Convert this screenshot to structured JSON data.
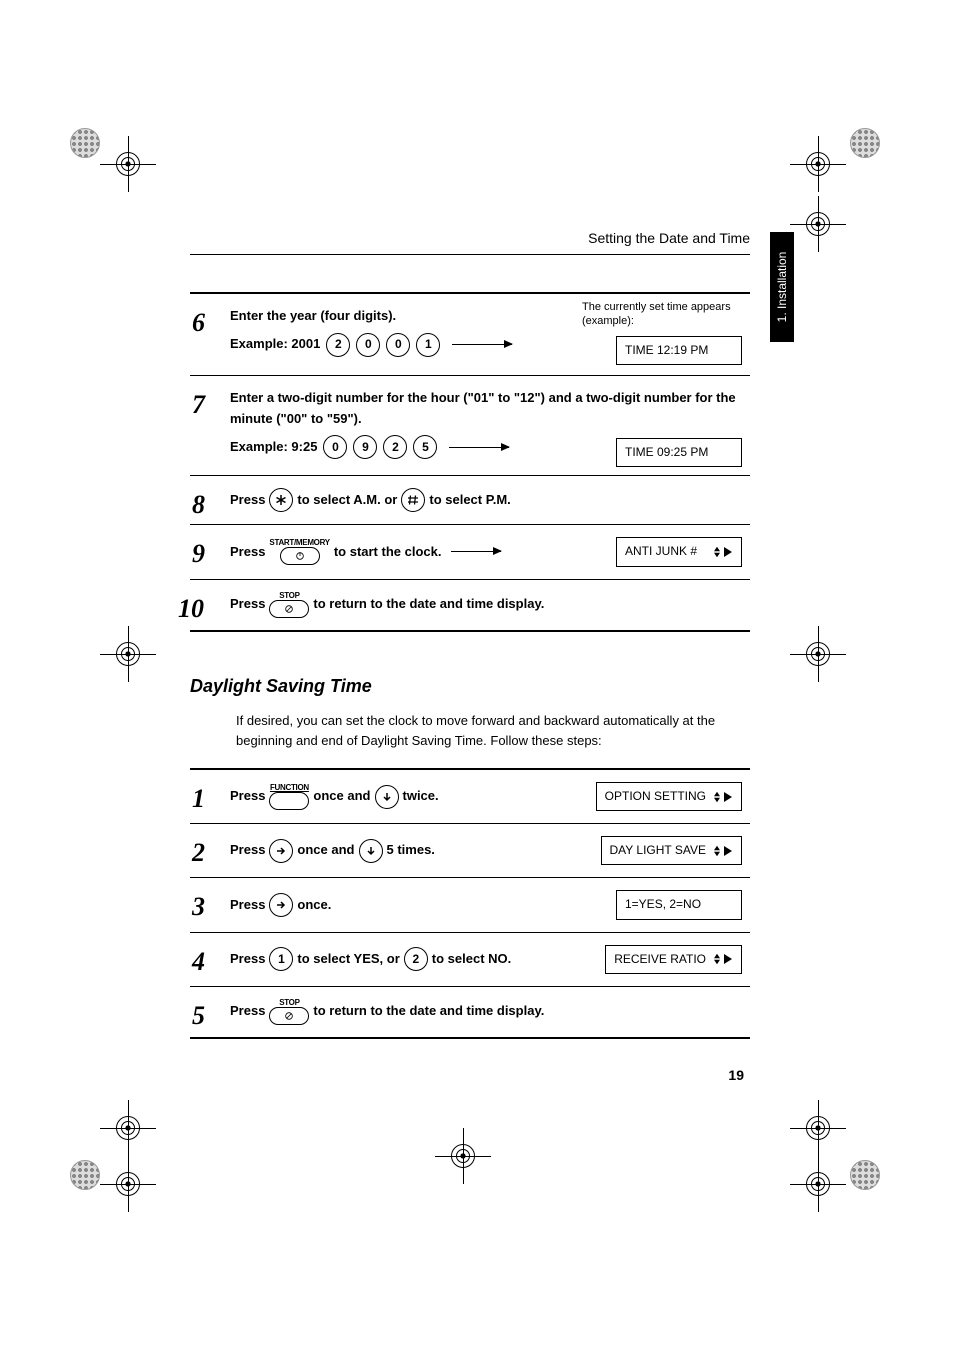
{
  "header": {
    "running_title": "Setting the Date and Time",
    "tab_label": "1. Installation",
    "page_number": "19"
  },
  "top_steps": {
    "s6": {
      "num": "6",
      "line1": "Enter the year (four digits).",
      "example_label": "Example: 2001",
      "keys": [
        "2",
        "0",
        "0",
        "1"
      ],
      "note": "The currently set time appears (example):",
      "display": "TIME 12:19 PM"
    },
    "s7": {
      "num": "7",
      "line1": "Enter a two-digit number for the hour (\"01\" to \"12\") and a two-digit number for the minute (\"00\" to \"59\").",
      "example_label": "Example: 9:25",
      "keys": [
        "0",
        "9",
        "2",
        "5"
      ],
      "display": "TIME 09:25 PM"
    },
    "s8": {
      "num": "8",
      "pre": "Press",
      "mid1": "to select A.M. or",
      "mid2": "to select P.M."
    },
    "s9": {
      "num": "9",
      "pre": "Press",
      "label": "START/MEMORY",
      "post": "to start the clock.",
      "display": "ANTI JUNK #"
    },
    "s10": {
      "num": "10",
      "pre": "Press",
      "label": "STOP",
      "post": "to return to the date and time display."
    }
  },
  "section2": {
    "heading": "Daylight Saving Time",
    "intro": "If desired, you can set the clock to move forward and backward automatically at the beginning and end of Daylight Saving Time. Follow these steps:",
    "s1": {
      "num": "1",
      "pre": "Press",
      "func_label": "FUNCTION",
      "mid": "once and",
      "post": "twice.",
      "display": "OPTION SETTING"
    },
    "s2": {
      "num": "2",
      "pre": "Press",
      "mid": "once and",
      "post": "5 times.",
      "display": "DAY LIGHT SAVE"
    },
    "s3": {
      "num": "3",
      "pre": "Press",
      "post": "once.",
      "display": "1=YES, 2=NO"
    },
    "s4": {
      "num": "4",
      "pre": "Press",
      "mid": "to select YES, or",
      "post": "to select NO.",
      "display": "RECEIVE RATIO"
    },
    "s5": {
      "num": "5",
      "pre": "Press",
      "label": "STOP",
      "post": "to return to the date and time display."
    }
  }
}
